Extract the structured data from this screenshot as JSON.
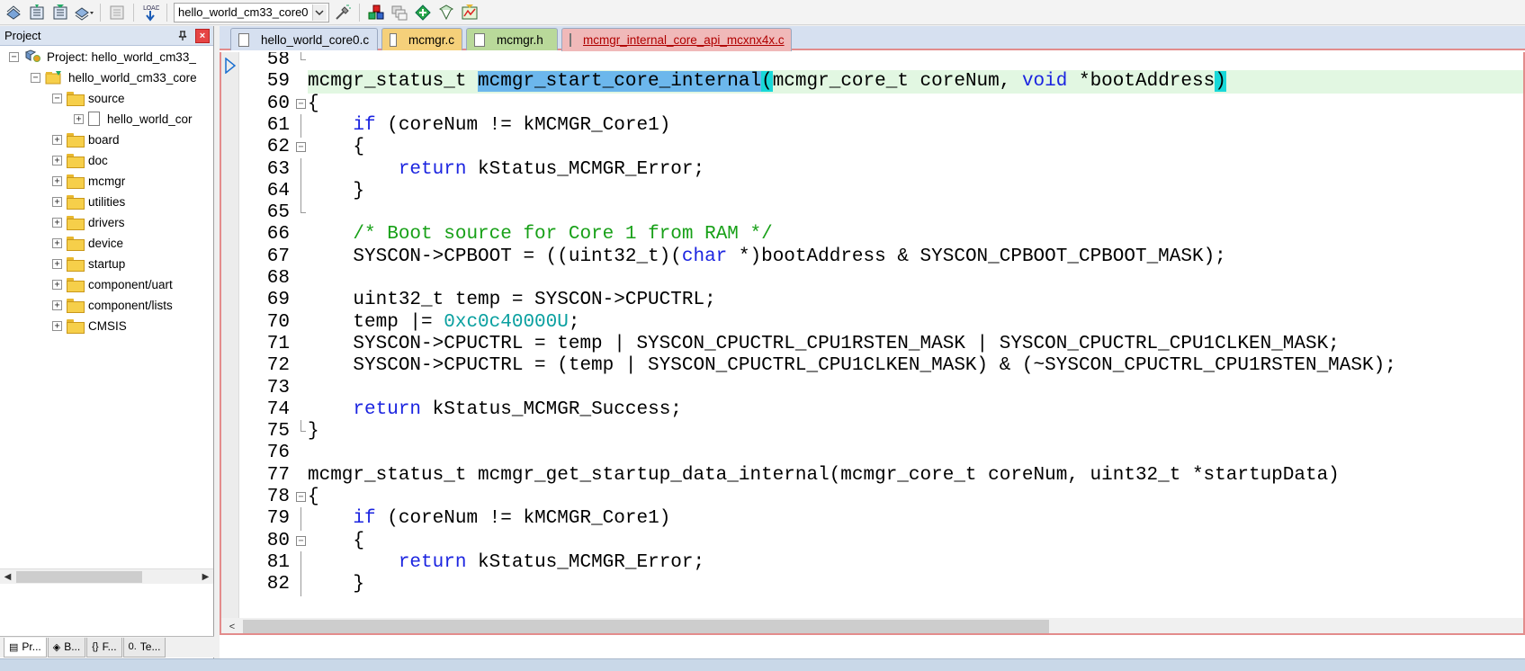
{
  "toolbar": {
    "target": "hello_world_cm33_core0"
  },
  "project_panel": {
    "title": "Project",
    "tree": [
      {
        "label": "Project: hello_world_cm33_",
        "level": 0,
        "type": "project",
        "expander": "⊟"
      },
      {
        "label": "hello_world_cm33_core",
        "level": 1,
        "type": "group-root",
        "expander": "⊟"
      },
      {
        "label": "source",
        "level": 2,
        "type": "folder",
        "expander": "⊟"
      },
      {
        "label": "hello_world_cor",
        "level": 3,
        "type": "file",
        "expander": "⊞"
      },
      {
        "label": "board",
        "level": 2,
        "type": "folder",
        "expander": "⊞"
      },
      {
        "label": "doc",
        "level": 2,
        "type": "folder",
        "expander": "⊞"
      },
      {
        "label": "mcmgr",
        "level": 2,
        "type": "folder",
        "expander": "⊞"
      },
      {
        "label": "utilities",
        "level": 2,
        "type": "folder",
        "expander": "⊞"
      },
      {
        "label": "drivers",
        "level": 2,
        "type": "folder",
        "expander": "⊞"
      },
      {
        "label": "device",
        "level": 2,
        "type": "folder",
        "expander": "⊞"
      },
      {
        "label": "startup",
        "level": 2,
        "type": "folder",
        "expander": "⊞"
      },
      {
        "label": "component/uart",
        "level": 2,
        "type": "folder",
        "expander": "⊞"
      },
      {
        "label": "component/lists",
        "level": 2,
        "type": "folder",
        "expander": "⊞"
      },
      {
        "label": "CMSIS",
        "level": 2,
        "type": "folder",
        "expander": "⊞"
      }
    ],
    "tabs": [
      {
        "label": "Pr...",
        "icon": "▤"
      },
      {
        "label": "B...",
        "icon": "◈"
      },
      {
        "label": "F...",
        "icon": "{}"
      },
      {
        "label": "Te...",
        "icon": "0."
      }
    ]
  },
  "editor": {
    "tabs": [
      {
        "label": "hello_world_core0.c",
        "color": "#d6e0f0",
        "active": false
      },
      {
        "label": "mcmgr.c",
        "color": "#f5d07a",
        "active": false
      },
      {
        "label": "mcmgr.h",
        "color": "#b9d99a",
        "active": false
      },
      {
        "label": "mcmgr_internal_core_api_mcxnx4x.c",
        "color": "#f0b9b9",
        "active": true
      }
    ],
    "lines": [
      {
        "n": "58",
        "fold": "end",
        "parts": []
      },
      {
        "n": "59",
        "fold": "",
        "current": true,
        "parts": [
          {
            "t": "mcmgr_status_t "
          },
          {
            "t": "mcmgr_start_core_internal",
            "c": "sel"
          },
          {
            "t": "(",
            "c": "brace"
          },
          {
            "t": "mcmgr_core_t coreNum, "
          },
          {
            "t": "void",
            "c": "kw"
          },
          {
            "t": " *bootAddress"
          },
          {
            "t": ")",
            "c": "brace"
          }
        ]
      },
      {
        "n": "60",
        "fold": "box",
        "parts": [
          {
            "t": "{"
          }
        ]
      },
      {
        "n": "61",
        "fold": "line",
        "parts": [
          {
            "t": "    "
          },
          {
            "t": "if",
            "c": "kw"
          },
          {
            "t": " (coreNum != kMCMGR_Core1)"
          }
        ]
      },
      {
        "n": "62",
        "fold": "box",
        "parts": [
          {
            "t": "    {"
          }
        ]
      },
      {
        "n": "63",
        "fold": "line",
        "parts": [
          {
            "t": "        "
          },
          {
            "t": "return",
            "c": "kw"
          },
          {
            "t": " kStatus_MCMGR_Error;"
          }
        ]
      },
      {
        "n": "64",
        "fold": "line",
        "parts": [
          {
            "t": "    }"
          }
        ]
      },
      {
        "n": "65",
        "fold": "end",
        "parts": []
      },
      {
        "n": "66",
        "fold": "",
        "parts": [
          {
            "t": "    "
          },
          {
            "t": "/* Boot source for Core 1 from RAM */",
            "c": "cm"
          }
        ]
      },
      {
        "n": "67",
        "fold": "",
        "parts": [
          {
            "t": "    SYSCON->CPBOOT = ((uint32_t)("
          },
          {
            "t": "char",
            "c": "kw"
          },
          {
            "t": " *)bootAddress & SYSCON_CPBOOT_CPBOOT_MASK);"
          }
        ]
      },
      {
        "n": "68",
        "fold": "",
        "parts": []
      },
      {
        "n": "69",
        "fold": "",
        "parts": [
          {
            "t": "    uint32_t temp = SYSCON->CPUCTRL;"
          }
        ]
      },
      {
        "n": "70",
        "fold": "",
        "parts": [
          {
            "t": "    temp |= "
          },
          {
            "t": "0xc0c40000U",
            "c": "num"
          },
          {
            "t": ";"
          }
        ]
      },
      {
        "n": "71",
        "fold": "",
        "parts": [
          {
            "t": "    SYSCON->CPUCTRL = temp | SYSCON_CPUCTRL_CPU1RSTEN_MASK | SYSCON_CPUCTRL_CPU1CLKEN_MASK;"
          }
        ]
      },
      {
        "n": "72",
        "fold": "",
        "parts": [
          {
            "t": "    SYSCON->CPUCTRL = (temp | SYSCON_CPUCTRL_CPU1CLKEN_MASK) & (~SYSCON_CPUCTRL_CPU1RSTEN_MASK);"
          }
        ]
      },
      {
        "n": "73",
        "fold": "",
        "parts": []
      },
      {
        "n": "74",
        "fold": "",
        "parts": [
          {
            "t": "    "
          },
          {
            "t": "return",
            "c": "kw"
          },
          {
            "t": " kStatus_MCMGR_Success;"
          }
        ]
      },
      {
        "n": "75",
        "fold": "end",
        "parts": [
          {
            "t": "}"
          }
        ]
      },
      {
        "n": "76",
        "fold": "",
        "parts": []
      },
      {
        "n": "77",
        "fold": "",
        "parts": [
          {
            "t": "mcmgr_status_t mcmgr_get_startup_data_internal(mcmgr_core_t coreNum, uint32_t *startupData)"
          }
        ]
      },
      {
        "n": "78",
        "fold": "box",
        "parts": [
          {
            "t": "{"
          }
        ]
      },
      {
        "n": "79",
        "fold": "line",
        "parts": [
          {
            "t": "    "
          },
          {
            "t": "if",
            "c": "kw"
          },
          {
            "t": " (coreNum != kMCMGR_Core1)"
          }
        ]
      },
      {
        "n": "80",
        "fold": "box",
        "parts": [
          {
            "t": "    {"
          }
        ]
      },
      {
        "n": "81",
        "fold": "line",
        "parts": [
          {
            "t": "        "
          },
          {
            "t": "return",
            "c": "kw"
          },
          {
            "t": " kStatus_MCMGR_Error;"
          }
        ]
      },
      {
        "n": "82",
        "fold": "line",
        "parts": [
          {
            "t": "    }"
          }
        ]
      }
    ]
  }
}
